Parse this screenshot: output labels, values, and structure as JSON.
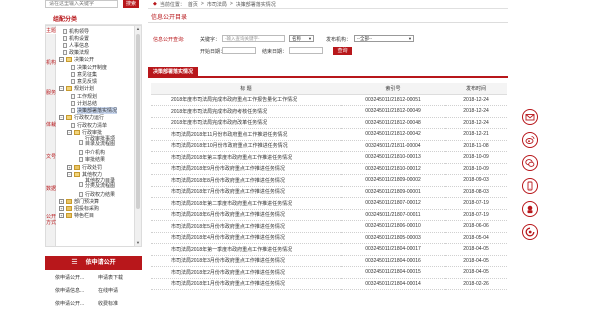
{
  "sidebar": {
    "search_placeholder": "请在这里输入关键字",
    "search_button": "搜索",
    "category_title": "组配分类",
    "vtabs": [
      "主题",
      "机构",
      "服务",
      "体裁",
      "文号",
      "数据",
      "公开方式"
    ],
    "tree": [
      {
        "label": "机构领导",
        "icon": "doc"
      },
      {
        "label": "机构设置",
        "icon": "doc"
      },
      {
        "label": "人事信息",
        "icon": "doc"
      },
      {
        "label": "政策法规",
        "icon": "doc"
      },
      {
        "label": "决策公开",
        "icon": "folder-open",
        "expander": "−"
      },
      {
        "label": "决策公开制度",
        "icon": "doc"
      },
      {
        "label": "意见征集",
        "icon": "doc"
      },
      {
        "label": "意见反馈",
        "icon": "doc"
      },
      {
        "label": "规划计划",
        "icon": "folder-open",
        "expander": "−"
      },
      {
        "label": "工作规划",
        "icon": "doc"
      },
      {
        "label": "计划总结",
        "icon": "doc"
      },
      {
        "label": "决策部署落实情况",
        "icon": "doc"
      },
      {
        "label": "行政权力运行",
        "icon": "folder-open",
        "expander": "−"
      },
      {
        "label": "行政权力清单",
        "icon": "doc"
      },
      {
        "label": "行政审批",
        "icon": "folder-open",
        "expander": "−"
      },
      {
        "label": "行政审批事项目录及流程图",
        "icon": "doc"
      },
      {
        "label": "中介机构",
        "icon": "doc"
      },
      {
        "label": "审批结果",
        "icon": "doc"
      },
      {
        "label": "行政处罚",
        "icon": "folder",
        "expander": "+"
      },
      {
        "label": "其他权力",
        "icon": "folder-open",
        "expander": "−"
      },
      {
        "label": "其他权力目录分类及流程图",
        "icon": "doc"
      },
      {
        "label": "行政权力结果",
        "icon": "doc"
      },
      {
        "label": "部门预决算",
        "icon": "folder",
        "expander": "+"
      },
      {
        "label": "招投标采购",
        "icon": "folder",
        "expander": "+"
      },
      {
        "label": "特色栏目",
        "icon": "folder",
        "expander": "+"
      }
    ],
    "apply_title": "依申请公开",
    "apply_items": [
      "依申请公开...",
      "申请表下载",
      "依申请信息...",
      "在线申请",
      "依申请公开...",
      "收费标准"
    ]
  },
  "breadcrumb": [
    "当前位置：",
    "首页",
    ">",
    "市司法局",
    ">",
    "决策部署落实情况"
  ],
  "section_title": "信息公开目录",
  "query": {
    "label": "信息公开查询:",
    "keyword_label": "关键字：",
    "keyword_placeholder": "-输入查询关键字-",
    "name_select": "名称",
    "org_label": "发布机构：",
    "org_select": "--全部--",
    "start_label": "开始日期：",
    "end_label": "结束日期：",
    "query_button": "查询"
  },
  "list_tab": "决策部署落实情况",
  "table": {
    "headers": [
      "标 题",
      "索引号",
      "发布时间"
    ],
    "rows": [
      [
        "2018年度市司法局完成市政府重点工作报告量化工作情况",
        "003245011/21812-00051",
        "2018-12-24"
      ],
      [
        "2018年度市司法局完成市政府考核任务情况",
        "003245011/21812-00049",
        "2018-12-24"
      ],
      [
        "2018年度市司法局完成市政府改革任务情况",
        "003245011/21812-00048",
        "2018-12-24"
      ],
      [
        "市司法局2018年11月份市政府重点工作推进任务情况",
        "003245011/21812-00042",
        "2018-12-21"
      ],
      [
        "市司法局2018年10月份市政府重点工作推进任务情况",
        "003245011/21811-00004",
        "2018-11-08"
      ],
      [
        "市司法局2018年第三季度市政府重点工作推进任务情况",
        "003245011/21810-00013",
        "2018-10-09"
      ],
      [
        "市司法局2018年9月份市政府重点工作推进任务情况",
        "003245011/21810-00012",
        "2018-10-09"
      ],
      [
        "市司法局2018年8月份市政府重点工作推进任务情况",
        "003245011/21809-00002",
        "2018-09-03"
      ],
      [
        "市司法局2018年7月份市政府重点工作推进任务情况",
        "003245011/21809-00001",
        "2018-08-03"
      ],
      [
        "市司法局2018年第二季度市政府重点工作推进任务情况",
        "003245011/21807-00012",
        "2018-07-19"
      ],
      [
        "市司法局2018年6月份市政府重点工作推进任务情况",
        "003245011/21807-00011",
        "2018-07-19"
      ],
      [
        "市司法局2018年5月份市政府重点工作推进任务情况",
        "003245011/21806-00010",
        "2018-06-06"
      ],
      [
        "市司法局2018年4月份市政府重点工作推进任务情况",
        "003245011/21805-00003",
        "2018-05-04"
      ],
      [
        "市司法局2018年第一季度市政府重点工作推进任务情况",
        "003245011/21804-00017",
        "2018-04-05"
      ],
      [
        "市司法局2018年3月份市政府重点工作推进任务情况",
        "003245011/21804-00016",
        "2018-04-05"
      ],
      [
        "市司法局2018年2月份市政府重点工作推进任务情况",
        "003245011/21804-00015",
        "2018-04-05"
      ],
      [
        "市司法局2018年1月份市政府重点工作推进任务情况",
        "003245011/21804-00014",
        "2018-02-26"
      ]
    ]
  },
  "float_icons": [
    "mail-icon",
    "weibo-icon",
    "wechat-icon",
    "mobile-icon",
    "mascot-icon",
    "emblem-icon"
  ],
  "colors": {
    "accent": "#b8171b"
  }
}
